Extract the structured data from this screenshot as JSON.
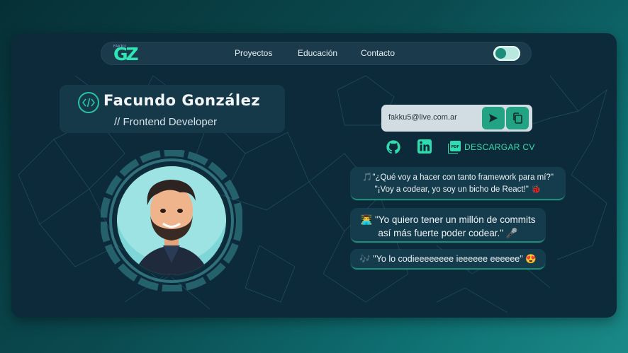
{
  "nav": {
    "logo_small": "FAKKU",
    "logo_main": "GZ",
    "links": [
      "Proyectos",
      "Educación",
      "Contacto"
    ]
  },
  "profile": {
    "name": "Facundo González",
    "role": "// Frontend Developer"
  },
  "contact": {
    "email": "fakku5@live.com.ar",
    "cv_label": "DESCARGAR CV"
  },
  "quotes": {
    "q1_line1": "🎵\"¿Qué voy a hacer con tanto framework para mí?\"",
    "q1_line2": "\"¡Voy a codear, yo soy un bicho de React!\" 🐞",
    "q2_line1": "👨‍💻 \"Yo quiero tener un millón de commits",
    "q2_line2": "así más fuerte poder codear.\" 🎤",
    "q3": "🎶 \"Yo lo codieeeeeeee ieeeeee eeeeee\" 😍"
  },
  "colors": {
    "accent": "#2ee6b3",
    "card_bg": "#0d2a3b",
    "button": "#22a383"
  },
  "icons": [
    "code-icon",
    "send-icon",
    "copy-icon",
    "github-icon",
    "linkedin-icon",
    "pdf-icon"
  ]
}
